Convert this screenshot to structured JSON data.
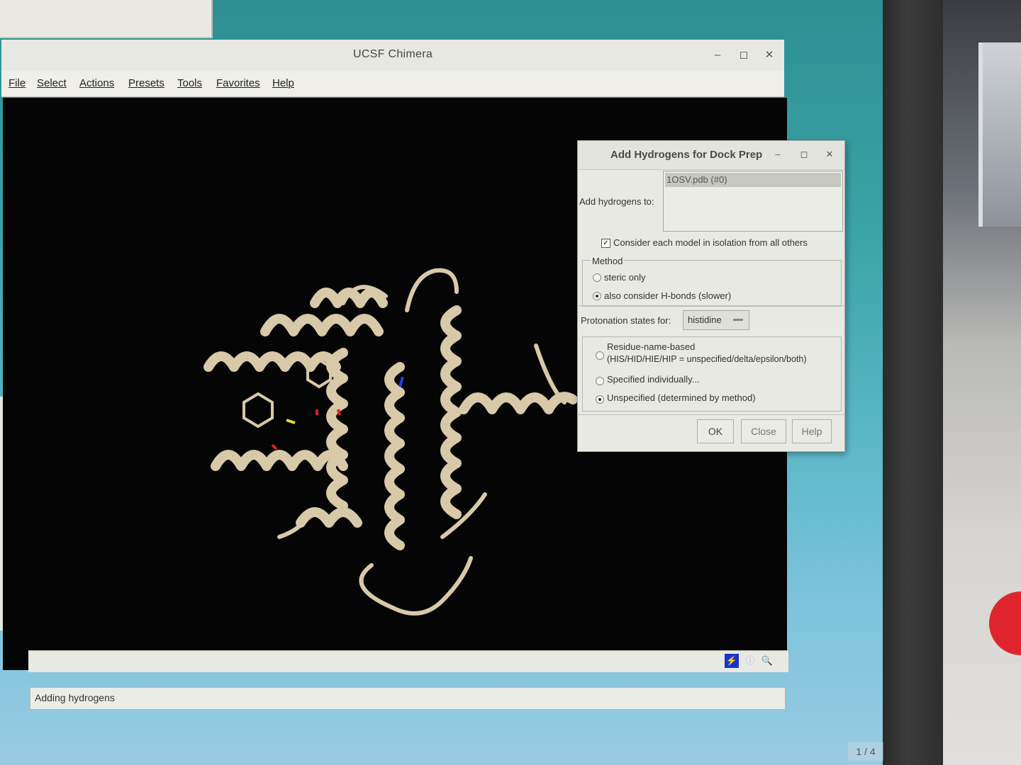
{
  "window": {
    "title": "UCSF Chimera",
    "controls": {
      "minimize": "–",
      "maximize": "◻",
      "close": "✕"
    }
  },
  "menu": [
    "File",
    "Select",
    "Actions",
    "Presets",
    "Tools",
    "Favorites",
    "Help"
  ],
  "status": {
    "text": "Adding hydrogens"
  },
  "dialog": {
    "title": "Add Hydrogens for Dock Prep",
    "controls": {
      "minimize": "–",
      "maximize": "◻",
      "close": "✕"
    },
    "add_to_label": "Add hydrogens to:",
    "models": [
      "1OSV.pdb (#0)"
    ],
    "isolation_checkbox": {
      "label": "Consider each model in isolation from all others",
      "checked": true
    },
    "method": {
      "legend": "Method",
      "options": [
        {
          "label": "steric only",
          "selected": false
        },
        {
          "label": "also consider H-bonds (slower)",
          "selected": true
        }
      ]
    },
    "protonation": {
      "label": "Protonation states for:",
      "selected": "histidine",
      "options": [
        {
          "label": "Residue-name-based",
          "sublabel": "(HIS/HID/HIE/HIP = unspecified/delta/epsilon/both)",
          "selected": false
        },
        {
          "label": "Specified individually...",
          "selected": false
        },
        {
          "label": "Unspecified (determined by method)",
          "selected": true
        }
      ]
    },
    "buttons": {
      "ok": "OK",
      "close": "Close",
      "help": "Help"
    }
  },
  "page_counter": "1 / 4",
  "colors": {
    "viewer_background": "#050505",
    "ribbon": "#d8c9a8",
    "dialog_background": "#e9e9e3",
    "desktop": "#3aa3a6"
  }
}
